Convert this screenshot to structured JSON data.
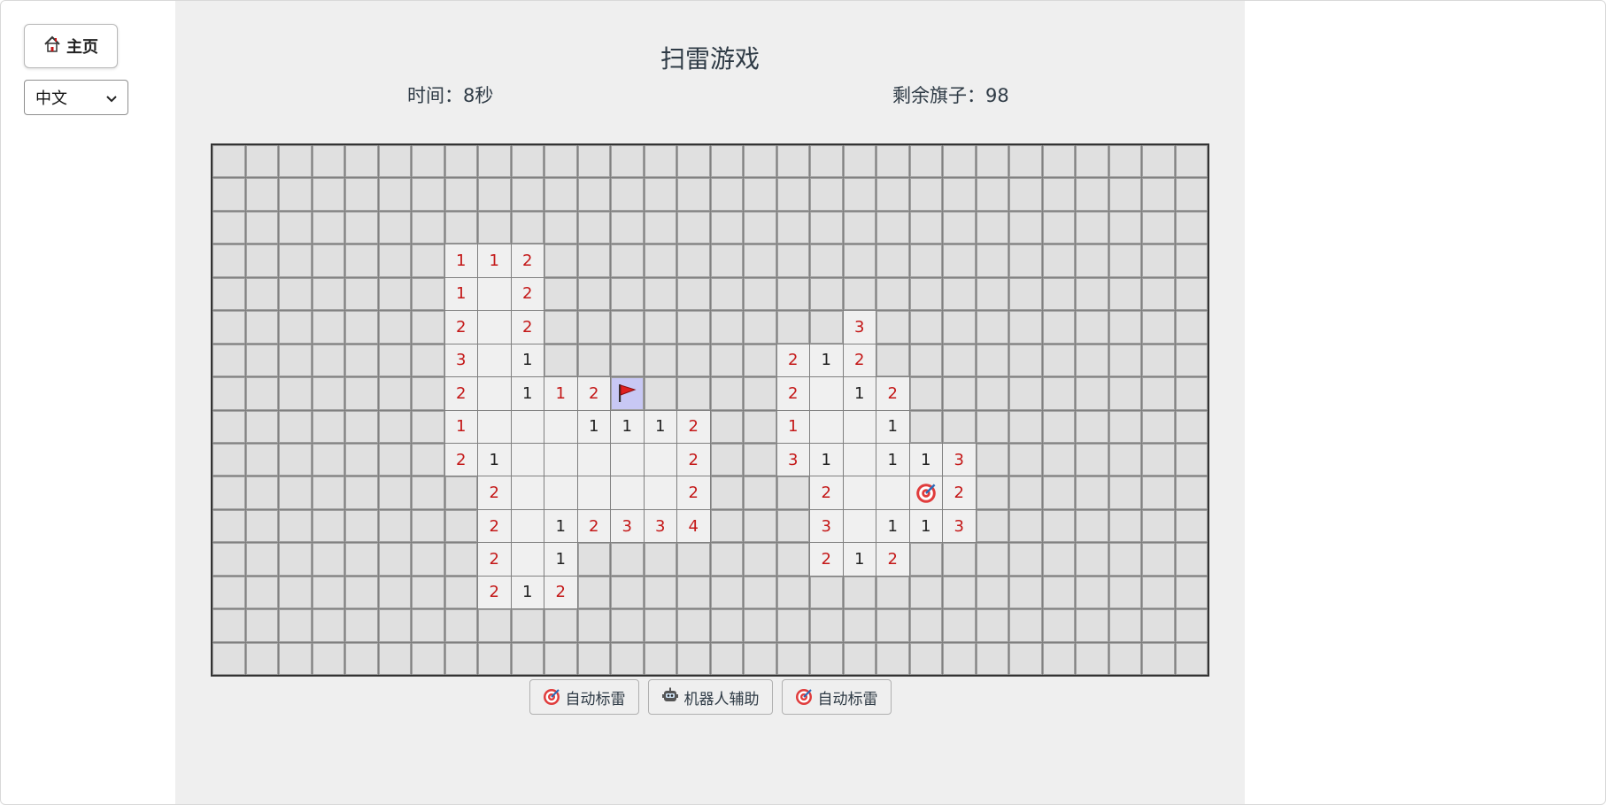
{
  "home": {
    "label": "主页",
    "icon": "house-icon"
  },
  "language": {
    "selected": "中文"
  },
  "game": {
    "title": "扫雷游戏",
    "time_label": "时间：8秒",
    "flags_label": "剩余旗子：98",
    "rows": 16,
    "cols": 30,
    "cells": [
      {
        "r": 3,
        "c": 7,
        "v": "1",
        "cls": "n1 red"
      },
      {
        "r": 3,
        "c": 8,
        "v": "1",
        "cls": "n1 red"
      },
      {
        "r": 3,
        "c": 9,
        "v": "2",
        "cls": "n2"
      },
      {
        "r": 4,
        "c": 7,
        "v": "1",
        "cls": "n1 red"
      },
      {
        "r": 4,
        "c": 8,
        "v": "",
        "cls": ""
      },
      {
        "r": 4,
        "c": 9,
        "v": "2",
        "cls": "n2"
      },
      {
        "r": 5,
        "c": 7,
        "v": "2",
        "cls": "n2"
      },
      {
        "r": 5,
        "c": 8,
        "v": "",
        "cls": ""
      },
      {
        "r": 5,
        "c": 9,
        "v": "2",
        "cls": "n2"
      },
      {
        "r": 5,
        "c": 19,
        "v": "3",
        "cls": "n3"
      },
      {
        "r": 6,
        "c": 7,
        "v": "3",
        "cls": "n3"
      },
      {
        "r": 6,
        "c": 8,
        "v": "",
        "cls": ""
      },
      {
        "r": 6,
        "c": 9,
        "v": "1",
        "cls": "n1"
      },
      {
        "r": 6,
        "c": 17,
        "v": "2",
        "cls": "n2"
      },
      {
        "r": 6,
        "c": 18,
        "v": "1",
        "cls": "n1"
      },
      {
        "r": 6,
        "c": 19,
        "v": "2",
        "cls": "n2"
      },
      {
        "r": 7,
        "c": 7,
        "v": "2",
        "cls": "n2"
      },
      {
        "r": 7,
        "c": 8,
        "v": "",
        "cls": ""
      },
      {
        "r": 7,
        "c": 9,
        "v": "1",
        "cls": "n1"
      },
      {
        "r": 7,
        "c": 10,
        "v": "1",
        "cls": "n1 red"
      },
      {
        "r": 7,
        "c": 11,
        "v": "2",
        "cls": "n2"
      },
      {
        "r": 7,
        "c": 17,
        "v": "2",
        "cls": "n2"
      },
      {
        "r": 7,
        "c": 18,
        "v": "",
        "cls": ""
      },
      {
        "r": 7,
        "c": 19,
        "v": "1",
        "cls": "n1"
      },
      {
        "r": 7,
        "c": 20,
        "v": "2",
        "cls": "n2"
      },
      {
        "r": 8,
        "c": 7,
        "v": "1",
        "cls": "n1 red"
      },
      {
        "r": 8,
        "c": 8,
        "v": "",
        "cls": ""
      },
      {
        "r": 8,
        "c": 9,
        "v": "",
        "cls": ""
      },
      {
        "r": 8,
        "c": 10,
        "v": "",
        "cls": ""
      },
      {
        "r": 8,
        "c": 11,
        "v": "1",
        "cls": "n1"
      },
      {
        "r": 8,
        "c": 12,
        "v": "1",
        "cls": "n1"
      },
      {
        "r": 8,
        "c": 13,
        "v": "1",
        "cls": "n1"
      },
      {
        "r": 8,
        "c": 14,
        "v": "2",
        "cls": "n2"
      },
      {
        "r": 8,
        "c": 17,
        "v": "1",
        "cls": "n1 red"
      },
      {
        "r": 8,
        "c": 18,
        "v": "",
        "cls": ""
      },
      {
        "r": 8,
        "c": 19,
        "v": "",
        "cls": ""
      },
      {
        "r": 8,
        "c": 20,
        "v": "1",
        "cls": "n1"
      },
      {
        "r": 9,
        "c": 7,
        "v": "2",
        "cls": "n2"
      },
      {
        "r": 9,
        "c": 8,
        "v": "1",
        "cls": "n1"
      },
      {
        "r": 9,
        "c": 9,
        "v": "",
        "cls": ""
      },
      {
        "r": 9,
        "c": 10,
        "v": "",
        "cls": ""
      },
      {
        "r": 9,
        "c": 11,
        "v": "",
        "cls": ""
      },
      {
        "r": 9,
        "c": 12,
        "v": "",
        "cls": ""
      },
      {
        "r": 9,
        "c": 13,
        "v": "",
        "cls": ""
      },
      {
        "r": 9,
        "c": 14,
        "v": "2",
        "cls": "n2"
      },
      {
        "r": 9,
        "c": 17,
        "v": "3",
        "cls": "n3"
      },
      {
        "r": 9,
        "c": 18,
        "v": "1",
        "cls": "n1"
      },
      {
        "r": 9,
        "c": 19,
        "v": "",
        "cls": ""
      },
      {
        "r": 9,
        "c": 20,
        "v": "1",
        "cls": "n1"
      },
      {
        "r": 9,
        "c": 21,
        "v": "1",
        "cls": "n1"
      },
      {
        "r": 9,
        "c": 22,
        "v": "3",
        "cls": "n3"
      },
      {
        "r": 10,
        "c": 8,
        "v": "2",
        "cls": "n2"
      },
      {
        "r": 10,
        "c": 9,
        "v": "",
        "cls": ""
      },
      {
        "r": 10,
        "c": 10,
        "v": "",
        "cls": ""
      },
      {
        "r": 10,
        "c": 11,
        "v": "",
        "cls": ""
      },
      {
        "r": 10,
        "c": 12,
        "v": "",
        "cls": ""
      },
      {
        "r": 10,
        "c": 13,
        "v": "",
        "cls": ""
      },
      {
        "r": 10,
        "c": 14,
        "v": "2",
        "cls": "n2"
      },
      {
        "r": 10,
        "c": 18,
        "v": "2",
        "cls": "n2"
      },
      {
        "r": 10,
        "c": 19,
        "v": "",
        "cls": ""
      },
      {
        "r": 10,
        "c": 20,
        "v": "",
        "cls": ""
      },
      {
        "r": 10,
        "c": 22,
        "v": "2",
        "cls": "n2"
      },
      {
        "r": 11,
        "c": 8,
        "v": "2",
        "cls": "n2"
      },
      {
        "r": 11,
        "c": 9,
        "v": "",
        "cls": ""
      },
      {
        "r": 11,
        "c": 10,
        "v": "1",
        "cls": "n1"
      },
      {
        "r": 11,
        "c": 11,
        "v": "2",
        "cls": "n2"
      },
      {
        "r": 11,
        "c": 12,
        "v": "3",
        "cls": "n3"
      },
      {
        "r": 11,
        "c": 13,
        "v": "3",
        "cls": "n3"
      },
      {
        "r": 11,
        "c": 14,
        "v": "4",
        "cls": "n4"
      },
      {
        "r": 11,
        "c": 18,
        "v": "3",
        "cls": "n3"
      },
      {
        "r": 11,
        "c": 19,
        "v": "",
        "cls": ""
      },
      {
        "r": 11,
        "c": 20,
        "v": "1",
        "cls": "n1"
      },
      {
        "r": 11,
        "c": 21,
        "v": "1",
        "cls": "n1"
      },
      {
        "r": 11,
        "c": 22,
        "v": "3",
        "cls": "n3"
      },
      {
        "r": 12,
        "c": 8,
        "v": "2",
        "cls": "n2"
      },
      {
        "r": 12,
        "c": 9,
        "v": "",
        "cls": ""
      },
      {
        "r": 12,
        "c": 10,
        "v": "1",
        "cls": "n1"
      },
      {
        "r": 12,
        "c": 18,
        "v": "2",
        "cls": "n2"
      },
      {
        "r": 12,
        "c": 19,
        "v": "1",
        "cls": "n1"
      },
      {
        "r": 12,
        "c": 20,
        "v": "2",
        "cls": "n2"
      },
      {
        "r": 13,
        "c": 8,
        "v": "2",
        "cls": "n2"
      },
      {
        "r": 13,
        "c": 9,
        "v": "1",
        "cls": "n1"
      },
      {
        "r": 13,
        "c": 10,
        "v": "2",
        "cls": "n2"
      }
    ],
    "flag_cells": [
      {
        "r": 7,
        "c": 12
      }
    ],
    "target_cells": [
      {
        "r": 10,
        "c": 21
      }
    ]
  },
  "toolbar": {
    "auto_mark_1": "自动标雷",
    "robot_assist": "机器人辅助",
    "auto_mark_2": "自动标雷"
  }
}
